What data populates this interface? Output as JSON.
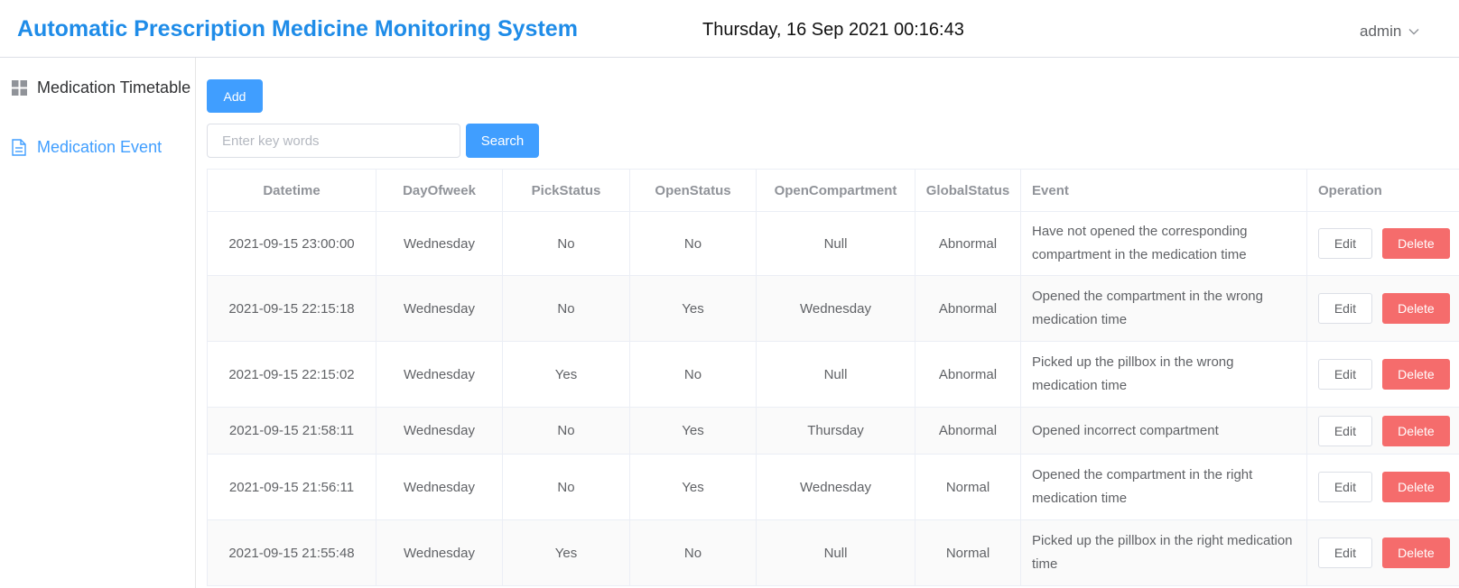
{
  "header": {
    "title": "Automatic Prescription Medicine Monitoring System",
    "datetime": "Thursday, 16 Sep 2021 00:16:43",
    "user": "admin"
  },
  "sidebar": {
    "items": [
      {
        "label": "Medication Timetable",
        "icon": "grid-icon",
        "active": false
      },
      {
        "label": "Medication Event",
        "icon": "document-icon",
        "active": true
      }
    ]
  },
  "toolbar": {
    "add_label": "Add",
    "search_placeholder": "Enter key words",
    "search_value": "",
    "search_label": "Search"
  },
  "table": {
    "columns": [
      "Datetime",
      "DayOfweek",
      "PickStatus",
      "OpenStatus",
      "OpenCompartment",
      "GlobalStatus",
      "Event",
      "Operation"
    ],
    "edit_label": "Edit",
    "delete_label": "Delete",
    "rows": [
      {
        "datetime": "2021-09-15 23:00:00",
        "day": "Wednesday",
        "pick": "No",
        "open": "No",
        "compartment": "Null",
        "global": "Abnormal",
        "event": "Have not opened the corresponding compartment in the medication time"
      },
      {
        "datetime": "2021-09-15 22:15:18",
        "day": "Wednesday",
        "pick": "No",
        "open": "Yes",
        "compartment": "Wednesday",
        "global": "Abnormal",
        "event": "Opened the compartment in the wrong medication time"
      },
      {
        "datetime": "2021-09-15 22:15:02",
        "day": "Wednesday",
        "pick": "Yes",
        "open": "No",
        "compartment": "Null",
        "global": "Abnormal",
        "event": "Picked up the pillbox in the wrong medication time"
      },
      {
        "datetime": "2021-09-15 21:58:11",
        "day": "Wednesday",
        "pick": "No",
        "open": "Yes",
        "compartment": "Thursday",
        "global": "Abnormal",
        "event": "Opened incorrect compartment"
      },
      {
        "datetime": "2021-09-15 21:56:11",
        "day": "Wednesday",
        "pick": "No",
        "open": "Yes",
        "compartment": "Wednesday",
        "global": "Normal",
        "event": "Opened the compartment in the right medication time"
      },
      {
        "datetime": "2021-09-15 21:55:48",
        "day": "Wednesday",
        "pick": "Yes",
        "open": "No",
        "compartment": "Null",
        "global": "Normal",
        "event": "Picked up the pillbox in the right medication time"
      }
    ]
  },
  "colors": {
    "primary": "#409eff",
    "title": "#1f8ce8",
    "danger": "#f56c6c"
  }
}
